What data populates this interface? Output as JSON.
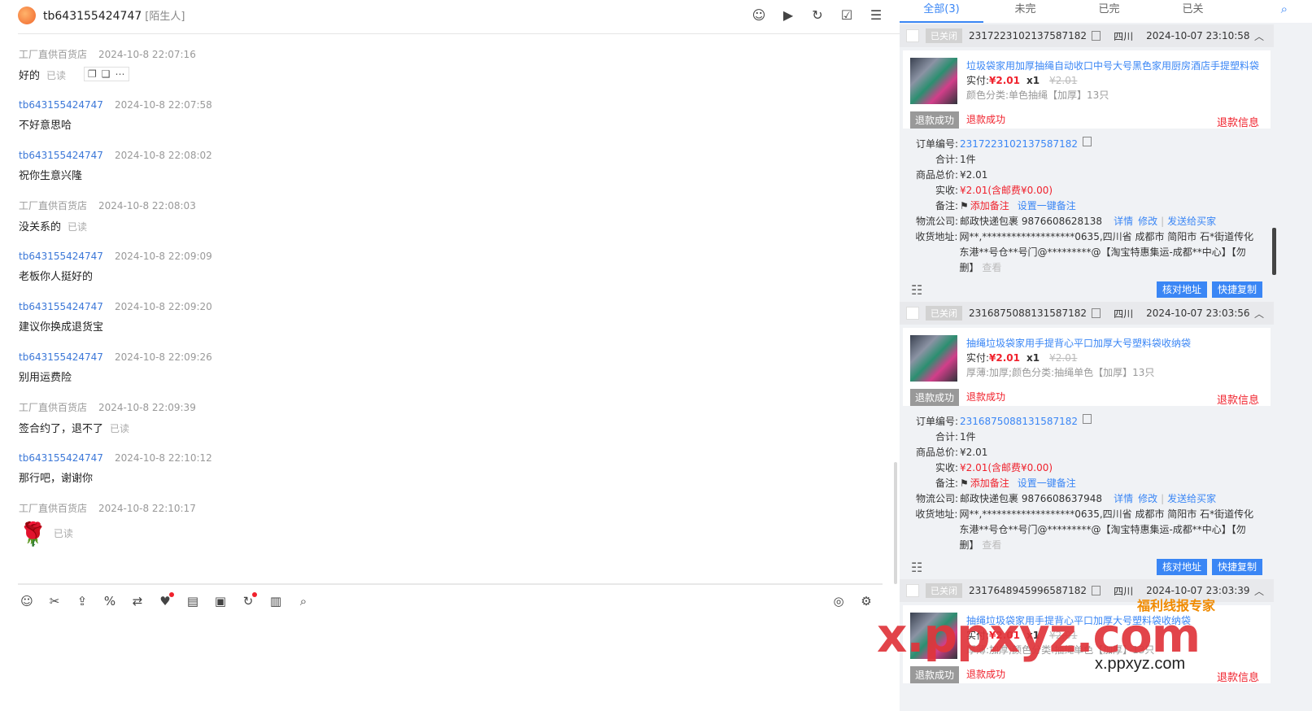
{
  "header": {
    "contact_name": "tb643155424747",
    "contact_tag": "[陌生人]"
  },
  "messages": [
    {
      "sender": "工厂直供百货店",
      "time": "2024-10-8 22:07:16",
      "text": "好的",
      "read": "已读",
      "role": "shop"
    },
    {
      "sender": "tb643155424747",
      "time": "2024-10-8 22:07:58",
      "text": "不好意思哈",
      "read": "",
      "role": "buyer"
    },
    {
      "sender": "tb643155424747",
      "time": "2024-10-8 22:08:02",
      "text": "祝你生意兴隆",
      "read": "",
      "role": "buyer"
    },
    {
      "sender": "工厂直供百货店",
      "time": "2024-10-8 22:08:03",
      "text": "没关系的",
      "read": "已读",
      "role": "shop"
    },
    {
      "sender": "tb643155424747",
      "time": "2024-10-8 22:09:09",
      "text": "老板你人挺好的",
      "read": "",
      "role": "buyer"
    },
    {
      "sender": "tb643155424747",
      "time": "2024-10-8 22:09:20",
      "text": "建议你换成退货宝",
      "read": "",
      "role": "buyer"
    },
    {
      "sender": "tb643155424747",
      "time": "2024-10-8 22:09:26",
      "text": "别用运费险",
      "read": "",
      "role": "buyer"
    },
    {
      "sender": "工厂直供百货店",
      "time": "2024-10-8 22:09:39",
      "text": "签合约了，退不了",
      "read": "已读",
      "role": "shop"
    },
    {
      "sender": "tb643155424747",
      "time": "2024-10-8 22:10:12",
      "text": "那行吧，谢谢你",
      "read": "",
      "role": "buyer"
    },
    {
      "sender": "工厂直供百货店",
      "time": "2024-10-8 22:10:17",
      "text": "🌹",
      "read": "已读",
      "role": "shop"
    }
  ],
  "tabs": [
    "全部(3)",
    "未完",
    "已完",
    "已关"
  ],
  "orders": [
    {
      "status": "已关闭",
      "id": "2317223102137587182",
      "province": "四川",
      "time": "2024-10-07 23:10:58",
      "title": "垃圾袋家用加厚抽绳自动收口中号大号黑色家用厨房酒店手提塑料袋",
      "pay_label": "实付:",
      "pay": "¥2.01",
      "qty": "x1",
      "orig": "¥2.01",
      "sku": "颜色分类:单色抽绳【加厚】13只",
      "refund_badge": "退款成功",
      "refund_text": "退款成功",
      "refund_info": "退款信息",
      "details": {
        "order_no_label": "订单编号:",
        "order_no": "2317223102137587182",
        "total_label": "合计:",
        "total": "1件",
        "goods_label": "商品总价:",
        "goods": "¥2.01",
        "received_label": "实收:",
        "received": "¥2.01(含邮费¥0.00)",
        "note_label": "备注:",
        "note_add": "添加备注",
        "note_set": "设置一键备注",
        "logistics_label": "物流公司:",
        "logistics": "邮政快递包裹 9876608628138",
        "link_detail": "详情",
        "link_edit": "修改",
        "link_send": "发送给买家",
        "address_label": "收货地址:",
        "address": "网**,*******************0635,四川省 成都市 简阳市 石*街道传化东港**号仓**号门@*********@【淘宝特惠集运-成都**中心】【勿删】",
        "view": "查看",
        "btn_check": "核对地址",
        "btn_copy": "快捷复制"
      }
    },
    {
      "status": "已关闭",
      "id": "2316875088131587182",
      "province": "四川",
      "time": "2024-10-07 23:03:56",
      "title": "抽绳垃圾袋家用手提背心平口加厚大号塑料袋收纳袋",
      "pay_label": "实付:",
      "pay": "¥2.01",
      "qty": "x1",
      "orig": "¥2.01",
      "sku": "厚薄:加厚;颜色分类:抽绳单色【加厚】13只",
      "refund_badge": "退款成功",
      "refund_text": "退款成功",
      "refund_info": "退款信息",
      "details": {
        "order_no_label": "订单编号:",
        "order_no": "2316875088131587182",
        "total_label": "合计:",
        "total": "1件",
        "goods_label": "商品总价:",
        "goods": "¥2.01",
        "received_label": "实收:",
        "received": "¥2.01(含邮费¥0.00)",
        "note_label": "备注:",
        "note_add": "添加备注",
        "note_set": "设置一键备注",
        "logistics_label": "物流公司:",
        "logistics": "邮政快递包裹 9876608637948",
        "link_detail": "详情",
        "link_edit": "修改",
        "link_send": "发送给买家",
        "address_label": "收货地址:",
        "address": "网**,*******************0635,四川省 成都市 简阳市 石*街道传化东港**号仓**号门@*********@【淘宝特惠集运-成都**中心】【勿删】",
        "view": "查看",
        "btn_check": "核对地址",
        "btn_copy": "快捷复制"
      }
    },
    {
      "status": "已关闭",
      "id": "2317648945996587182",
      "province": "四川",
      "time": "2024-10-07 23:03:39",
      "title": "抽绳垃圾袋家用手提背心平口加厚大号塑料袋收纳袋",
      "pay_label": "实付:",
      "pay": "¥2.01",
      "qty": "x1",
      "orig": "¥2.01",
      "sku": "厚薄:加厚;颜色分类:抽绳单色【加厚】13只",
      "refund_badge": "退款成功",
      "refund_text": "退款成功",
      "refund_info": "退款信息"
    }
  ],
  "watermark": {
    "big": "x.ppxyz.com",
    "sub": "x.ppxyz.com",
    "tag": "福利线报专家"
  },
  "colors": {
    "accent": "#3a86f5",
    "price": "#f0212c",
    "panel_bg": "#f0f2f5"
  }
}
